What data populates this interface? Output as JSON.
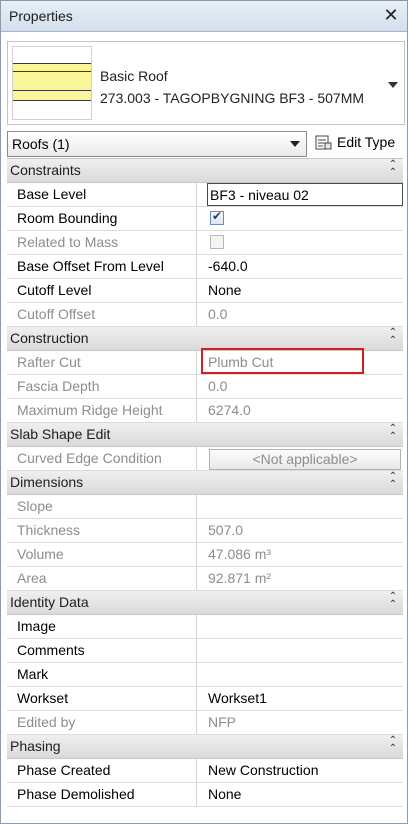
{
  "window": {
    "title": "Properties",
    "close_icon": "close-icon"
  },
  "type_selector": {
    "family": "Basic Roof",
    "type_name": "273.003 - TAGOPBYGNING BF3 - 507MM"
  },
  "instance_filter": {
    "selected": "Roofs (1)"
  },
  "edit_type": {
    "label": "Edit Type"
  },
  "sections": {
    "constraints": {
      "label": "Constraints",
      "base_level": {
        "name": "Base Level",
        "value": "BF3 - niveau 02"
      },
      "room_bounding": {
        "name": "Room Bounding",
        "checked": true
      },
      "related_to_mass": {
        "name": "Related to Mass",
        "checked": false
      },
      "base_offset": {
        "name": "Base Offset From Level",
        "value": "-640.0"
      },
      "cutoff_level": {
        "name": "Cutoff Level",
        "value": "None"
      },
      "cutoff_offset": {
        "name": "Cutoff Offset",
        "value": "0.0"
      }
    },
    "construction": {
      "label": "Construction",
      "rafter_cut": {
        "name": "Rafter Cut",
        "value": "Plumb Cut"
      },
      "fascia_depth": {
        "name": "Fascia Depth",
        "value": "0.0"
      },
      "max_ridge_height": {
        "name": "Maximum Ridge Height",
        "value": "6274.0"
      }
    },
    "slab_shape_edit": {
      "label": "Slab Shape Edit",
      "curved_edge": {
        "name": "Curved Edge Condition",
        "value": "<Not applicable>"
      }
    },
    "dimensions": {
      "label": "Dimensions",
      "slope": {
        "name": "Slope",
        "value": ""
      },
      "thickness": {
        "name": "Thickness",
        "value": "507.0"
      },
      "volume": {
        "name": "Volume",
        "value": "47.086 m³"
      },
      "area": {
        "name": "Area",
        "value": "92.871 m²"
      }
    },
    "identity_data": {
      "label": "Identity Data",
      "image": {
        "name": "Image",
        "value": ""
      },
      "comments": {
        "name": "Comments",
        "value": ""
      },
      "mark": {
        "name": "Mark",
        "value": ""
      },
      "workset": {
        "name": "Workset",
        "value": "Workset1"
      },
      "edited_by": {
        "name": "Edited by",
        "value": "NFP"
      }
    },
    "phasing": {
      "label": "Phasing",
      "phase_created": {
        "name": "Phase Created",
        "value": "New Construction"
      },
      "phase_demolished": {
        "name": "Phase Demolished",
        "value": "None"
      }
    }
  },
  "colors": {
    "highlight": "#d11f1f",
    "section_header": "#dadada",
    "readonly_text": "#8d8d8d",
    "preview_fill": "#fbf59a"
  }
}
